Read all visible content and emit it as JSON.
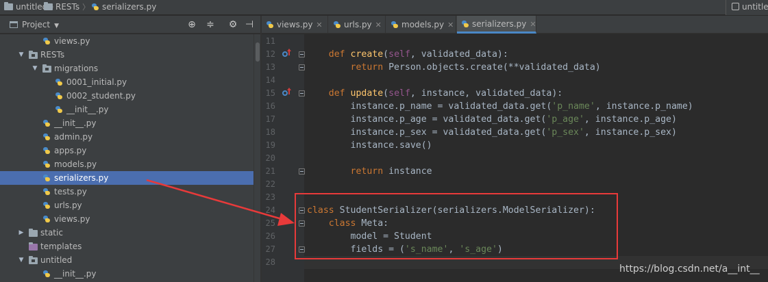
{
  "breadcrumbs": [
    {
      "label": "untitled",
      "icon": "folder-icon"
    },
    {
      "label": "RESTs",
      "icon": "folder-icon"
    },
    {
      "label": "serializers.py",
      "icon": "python-file-icon"
    }
  ],
  "right_tab": {
    "label": "untitle"
  },
  "project_panel": {
    "title": "Project",
    "header_icons": [
      "target-icon",
      "collapse-icon",
      "gear-icon",
      "hide-icon"
    ]
  },
  "tree": [
    {
      "label": "views.py",
      "type": "file",
      "indent": 3
    },
    {
      "label": "RESTs",
      "type": "package",
      "indent": 2,
      "expanded": true
    },
    {
      "label": "migrations",
      "type": "package",
      "indent": 3,
      "expanded": true
    },
    {
      "label": "0001_initial.py",
      "type": "file",
      "indent": 4
    },
    {
      "label": "0002_student.py",
      "type": "file",
      "indent": 4
    },
    {
      "label": "__init__.py",
      "type": "file",
      "indent": 4
    },
    {
      "label": "__init__.py",
      "type": "file",
      "indent": 3
    },
    {
      "label": "admin.py",
      "type": "file",
      "indent": 3
    },
    {
      "label": "apps.py",
      "type": "file",
      "indent": 3
    },
    {
      "label": "models.py",
      "type": "file",
      "indent": 3
    },
    {
      "label": "serializers.py",
      "type": "file",
      "indent": 3,
      "selected": true
    },
    {
      "label": "tests.py",
      "type": "file",
      "indent": 3
    },
    {
      "label": "urls.py",
      "type": "file",
      "indent": 3
    },
    {
      "label": "views.py",
      "type": "file",
      "indent": 3
    },
    {
      "label": "static",
      "type": "folder",
      "indent": 2,
      "expanded": false
    },
    {
      "label": "templates",
      "type": "folder-purple",
      "indent": 2,
      "expanded": null
    },
    {
      "label": "untitled",
      "type": "package",
      "indent": 2,
      "expanded": true
    },
    {
      "label": "__init__.py",
      "type": "file",
      "indent": 3
    }
  ],
  "editor_tabs": [
    {
      "label": "views.py",
      "active": false
    },
    {
      "label": "urls.py",
      "active": false
    },
    {
      "label": "models.py",
      "active": false
    },
    {
      "label": "serializers.py",
      "active": true
    }
  ],
  "code_lines": [
    {
      "n": "11",
      "tokens": []
    },
    {
      "n": "12",
      "marker": "override",
      "fold": true,
      "tokens": [
        [
          "",
          "    "
        ],
        [
          "kw",
          "def "
        ],
        [
          "fn",
          "create"
        ],
        [
          "",
          "("
        ],
        [
          "self",
          "self"
        ],
        [
          "",
          ", validated_data):"
        ]
      ]
    },
    {
      "n": "13",
      "fold": true,
      "tokens": [
        [
          "",
          "        "
        ],
        [
          "kw",
          "return "
        ],
        [
          "",
          "Person.objects.create(**validated_data)"
        ]
      ]
    },
    {
      "n": "14",
      "tokens": []
    },
    {
      "n": "15",
      "marker": "override",
      "fold": true,
      "tokens": [
        [
          "",
          "    "
        ],
        [
          "kw",
          "def "
        ],
        [
          "fn",
          "update"
        ],
        [
          "",
          "("
        ],
        [
          "self",
          "self"
        ],
        [
          "",
          ", instance, validated_data):"
        ]
      ]
    },
    {
      "n": "16",
      "tokens": [
        [
          "",
          "        instance.p_name = validated_data.get("
        ],
        [
          "str",
          "'p_name'"
        ],
        [
          "",
          ", instance.p_name)"
        ]
      ]
    },
    {
      "n": "17",
      "tokens": [
        [
          "",
          "        instance.p_age = validated_data.get("
        ],
        [
          "str",
          "'p_age'"
        ],
        [
          "",
          ", instance.p_age)"
        ]
      ]
    },
    {
      "n": "18",
      "tokens": [
        [
          "",
          "        instance.p_sex = validated_data.get("
        ],
        [
          "str",
          "'p_sex'"
        ],
        [
          "",
          ", instance.p_sex)"
        ]
      ]
    },
    {
      "n": "19",
      "tokens": [
        [
          "",
          "        instance.save()"
        ]
      ]
    },
    {
      "n": "20",
      "tokens": []
    },
    {
      "n": "21",
      "fold": true,
      "tokens": [
        [
          "",
          "        "
        ],
        [
          "kw",
          "return "
        ],
        [
          "",
          "instance"
        ]
      ]
    },
    {
      "n": "22",
      "tokens": []
    },
    {
      "n": "23",
      "tokens": []
    },
    {
      "n": "24",
      "fold": true,
      "tokens": [
        [
          "kw",
          "class "
        ],
        [
          "",
          "StudentSerializer(serializers.ModelSerializer):"
        ]
      ]
    },
    {
      "n": "25",
      "fold": true,
      "tokens": [
        [
          "",
          "    "
        ],
        [
          "kw",
          "class "
        ],
        [
          "",
          "Meta:"
        ]
      ]
    },
    {
      "n": "26",
      "tokens": [
        [
          "",
          "        model = Student"
        ]
      ]
    },
    {
      "n": "27",
      "fold": true,
      "tokens": [
        [
          "",
          "        fields = ("
        ],
        [
          "str",
          "'s_name'"
        ],
        [
          "",
          ", "
        ],
        [
          "str",
          "'s_age'"
        ],
        [
          "",
          ")"
        ]
      ]
    },
    {
      "n": "28",
      "current": true,
      "tokens": []
    }
  ],
  "annotation": {
    "color": "#e83a3a"
  },
  "watermark": "https://blog.csdn.net/a__int__",
  "colors": {
    "editor_bg": "#2b2b2b",
    "panel_bg": "#3c3f41",
    "selection": "#4b6eaf",
    "keyword": "#cc7832",
    "function": "#ffc66d",
    "string": "#6a8759",
    "self": "#94558d"
  }
}
